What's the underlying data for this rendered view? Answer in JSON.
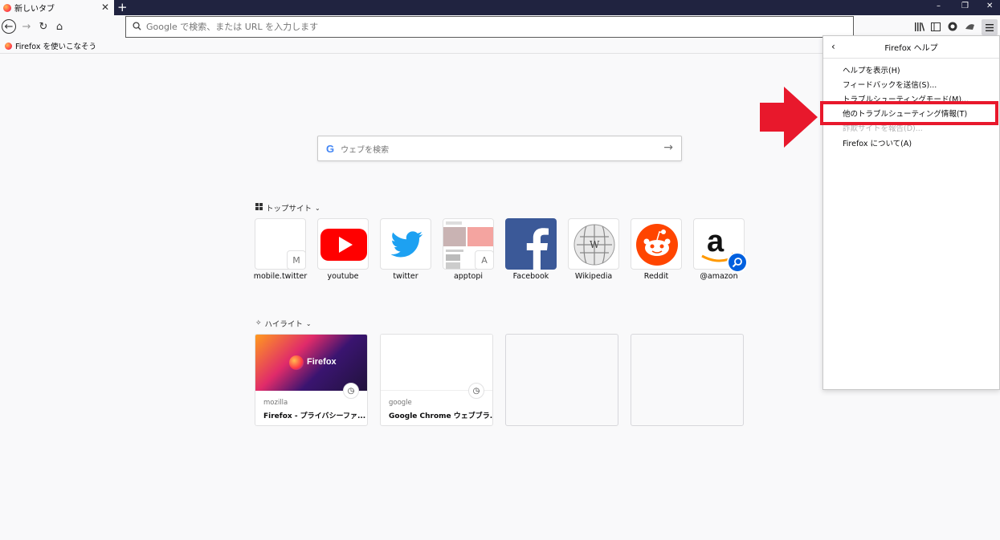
{
  "tab": {
    "title": "新しいタブ",
    "close": "✕",
    "new_tab": "+"
  },
  "window_controls": {
    "minimize": "–",
    "restore": "❐",
    "close": "✕"
  },
  "nav": {
    "back": "←",
    "forward": "→",
    "reload": "↻",
    "home": "⌂",
    "url_placeholder": "Google で検索、または URL を入力します"
  },
  "bookmarks": [
    {
      "label": "Firefox を使いこなそう"
    }
  ],
  "toolbar_icons": [
    "library-icon",
    "sidebar-icon",
    "account-icon",
    "extension-icon",
    "hamburger-menu-icon"
  ],
  "search": {
    "engine_mark": "G",
    "placeholder": "ウェブを検索",
    "submit": "→"
  },
  "top_sites": {
    "title": "トップサイト",
    "items": [
      {
        "label": "mobile.twitter",
        "badge": "M"
      },
      {
        "label": "youtube"
      },
      {
        "label": "twitter"
      },
      {
        "label": "apptopi",
        "badge": "A"
      },
      {
        "label": "Facebook"
      },
      {
        "label": "Wikipedia"
      },
      {
        "label": "Reddit"
      },
      {
        "label": "@amazon"
      }
    ]
  },
  "highlights": {
    "title": "ハイライト",
    "items": [
      {
        "domain": "mozilla",
        "title": "Firefox - プライバシーファ...",
        "image_text": "Firefox"
      },
      {
        "domain": "google",
        "title": "Google Chrome ウェブブラ..."
      }
    ]
  },
  "help_panel": {
    "title": "Firefox ヘルプ",
    "back": "‹",
    "items": [
      {
        "label": "ヘルプを表示(H)"
      },
      {
        "label": "フィードバックを送信(S)..."
      },
      {
        "label": "トラブルシューティングモード(M)..."
      },
      {
        "label": "他のトラブルシューティング情報(T)"
      },
      {
        "label": "詐欺サイトを報告(D)..."
      },
      {
        "label": "Firefox について(A)"
      }
    ]
  },
  "colors": {
    "accent_red": "#e8182c",
    "tabbar": "#202340",
    "facebook": "#3b5998",
    "reddit": "#ff4500",
    "youtube": "#ff0000",
    "twitter": "#1da1f2"
  }
}
